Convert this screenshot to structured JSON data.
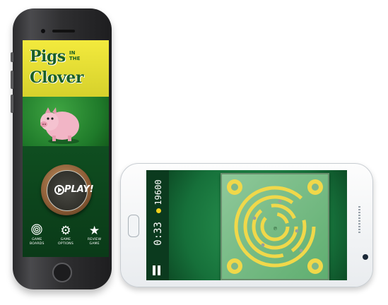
{
  "iphone_app": {
    "title_line1": "Pigs",
    "title_small": "IN THE",
    "title_line2": "Clover",
    "play_label": "PLAY!",
    "menu": [
      {
        "icon": "rings-icon",
        "label": "GAME\nBOARDS"
      },
      {
        "icon": "gear-icon",
        "label": "GAME\nOPTIONS"
      },
      {
        "icon": "star-icon",
        "label": "REVIEW\nGAME"
      }
    ]
  },
  "galaxy_game": {
    "score": "19600",
    "timer": "0:33"
  },
  "colors": {
    "title_yellow": "#f3ea3d",
    "title_green": "#1a5e24",
    "board_green": "#5fae70",
    "track_yellow": "#f0d84a",
    "coin": "#f2d01c"
  }
}
